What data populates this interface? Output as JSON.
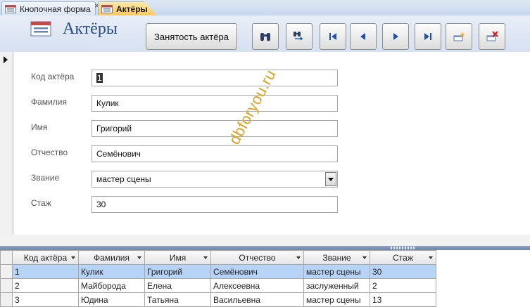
{
  "tabs": [
    {
      "label": "Кнопочная форма",
      "active": false
    },
    {
      "label": "Актёры",
      "active": true
    }
  ],
  "tab_close_glyph": "×",
  "form": {
    "title": "Актёры",
    "occupancy_button": "Занятость актёра",
    "toolbar_icons": [
      "find-icon",
      "replace-icon",
      "first-record-icon",
      "previous-record-icon",
      "next-record-icon",
      "last-record-icon",
      "new-record-icon",
      "delete-record-icon"
    ],
    "fields": {
      "actor_code": {
        "label": "Код актёра",
        "value": "1"
      },
      "surname": {
        "label": "Фамилия",
        "value": "Кулик"
      },
      "name": {
        "label": "Имя",
        "value": "Григорий"
      },
      "patronymic": {
        "label": "Отчество",
        "value": "Семёнович"
      },
      "rank": {
        "label": "Звание",
        "value": "мастер сцены"
      },
      "experience": {
        "label": "Стаж",
        "value": "30"
      }
    }
  },
  "watermark": "dbforyou.ru",
  "datasheet": {
    "columns": [
      "Код актёра",
      "Фамилия",
      "Имя",
      "Отчество",
      "Звание",
      "Стаж"
    ],
    "rows": [
      [
        "1",
        "Кулик",
        "Григорий",
        "Семёнович",
        "мастер сцены",
        "30"
      ],
      [
        "2",
        "Майборода",
        "Елена",
        "Алексеевна",
        "заслуженный",
        "2"
      ],
      [
        "3",
        "Юдина",
        "Татьяна",
        "Васильевна",
        "мастер сцены",
        "13"
      ]
    ],
    "current_row": 0
  },
  "colors": {
    "title": "#2a4f85",
    "active_tab": "#fbc95c",
    "selected_row": "#b7d3f5",
    "watermark": "#e0a020"
  }
}
